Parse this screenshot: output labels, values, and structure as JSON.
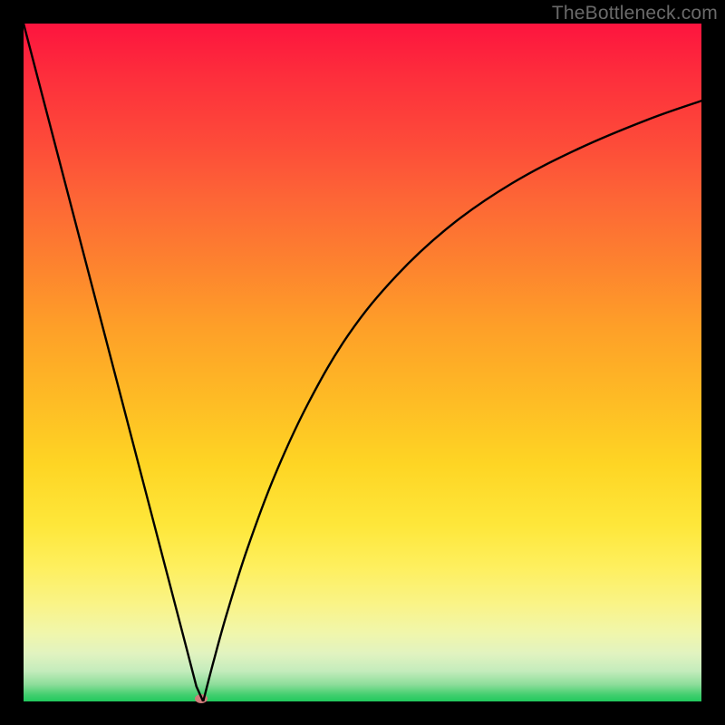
{
  "watermark": "TheBottleneck.com",
  "colors": {
    "frame_bg": "#000000",
    "curve_stroke": "#000000",
    "marker_fill": "#d07c7a"
  },
  "chart_data": {
    "type": "line",
    "title": "",
    "xlabel": "",
    "ylabel": "",
    "xlim": [
      0,
      100
    ],
    "ylim": [
      0,
      100
    ],
    "notes": "V-shaped bottleneck curve. Left branch is near-linear descending from top-left to the minimum; right branch rises with decreasing slope toward the top-right. Minimum near x≈26 touches y≈0. Axes, ticks and labels are not shown.",
    "series": [
      {
        "name": "left-branch",
        "x": [
          0,
          3,
          6,
          9,
          12,
          15,
          18,
          21,
          24,
          25.5,
          26.5
        ],
        "y": [
          100,
          88.5,
          77,
          65.5,
          54,
          42.5,
          31,
          19.5,
          8,
          2.2,
          0
        ]
      },
      {
        "name": "right-branch",
        "x": [
          26.5,
          28,
          30,
          33,
          37,
          42,
          48,
          55,
          63,
          72,
          82,
          92,
          100
        ],
        "y": [
          0,
          5.8,
          13.0,
          22.5,
          33.2,
          44.0,
          54.2,
          62.8,
          70.2,
          76.4,
          81.6,
          85.8,
          88.6
        ]
      }
    ],
    "marker": {
      "x": 26.2,
      "y": 0.4
    }
  }
}
